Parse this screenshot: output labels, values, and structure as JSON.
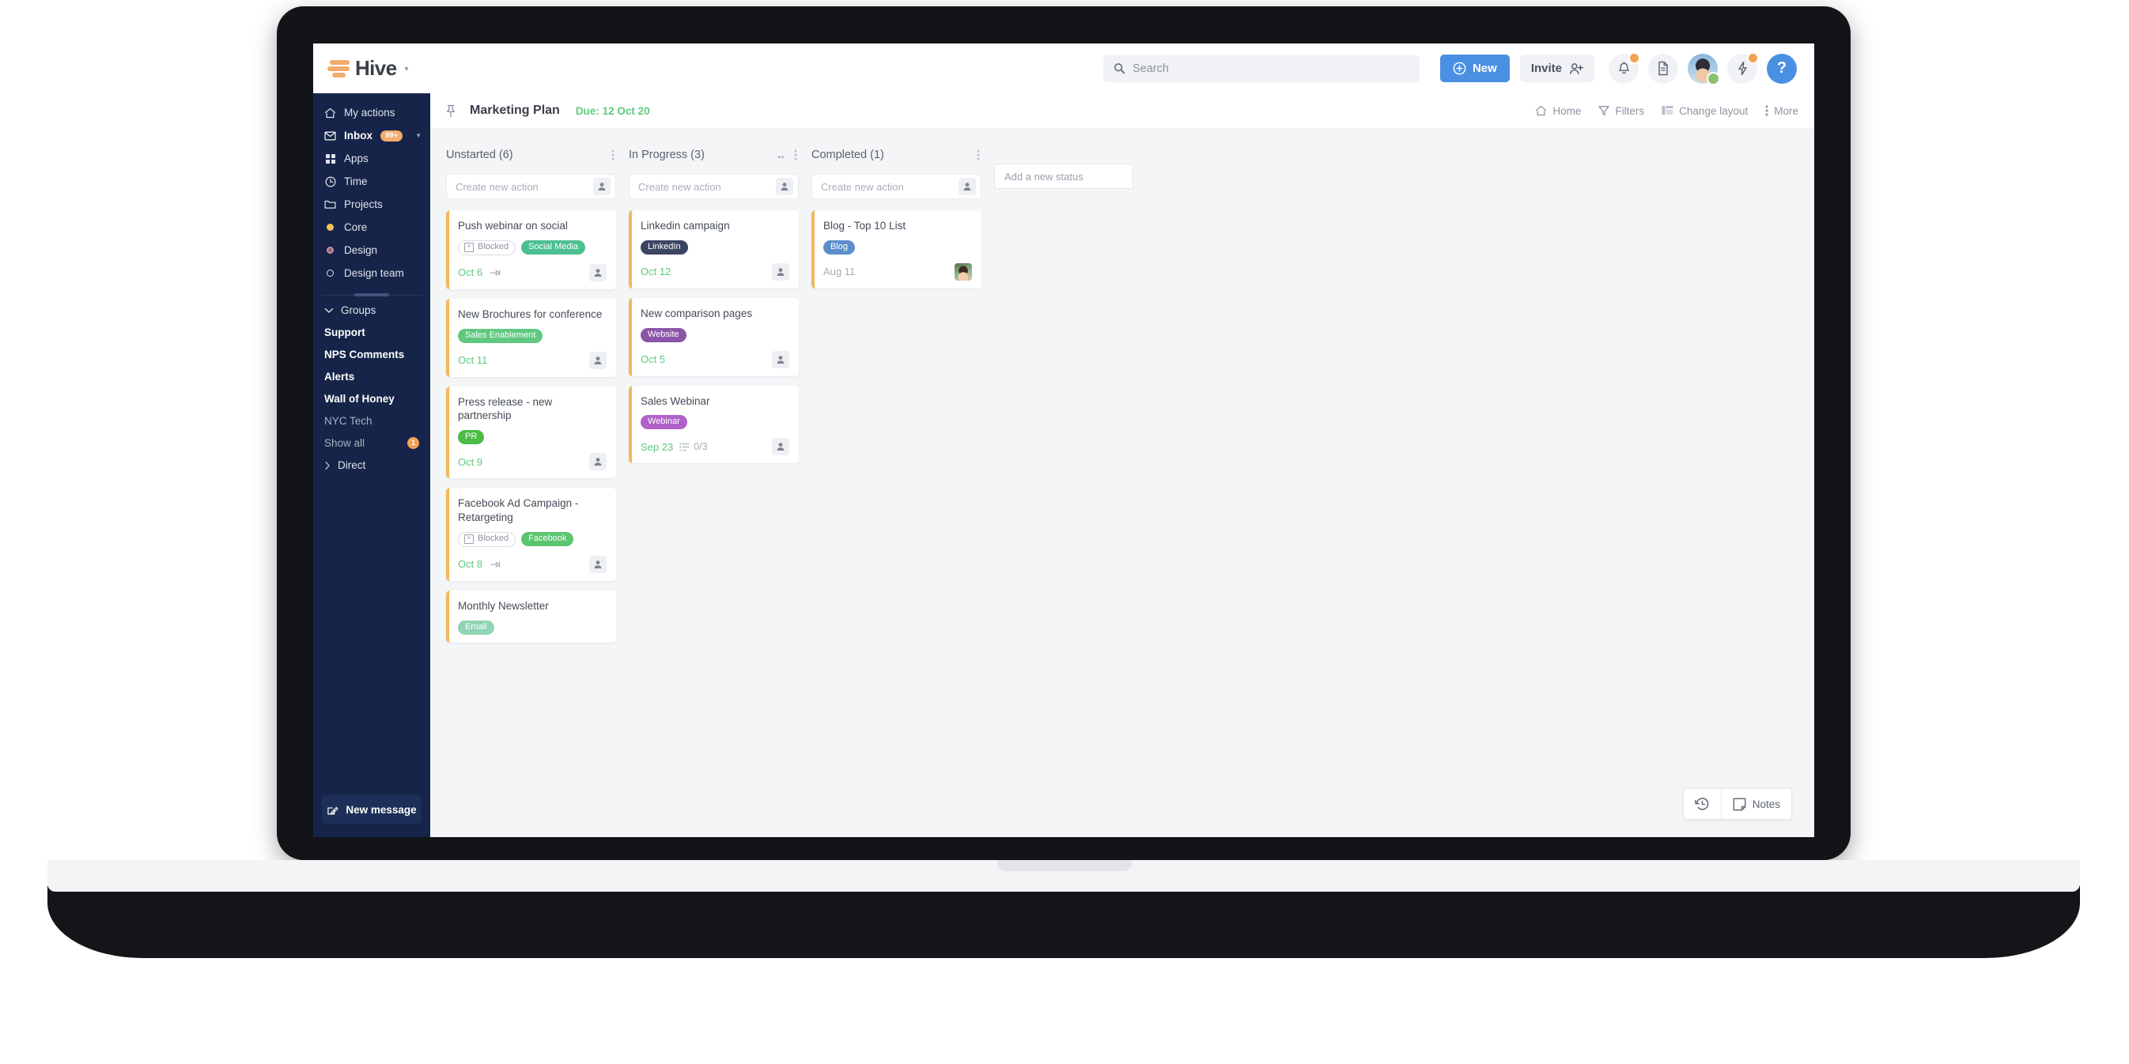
{
  "brand": {
    "name": "Hive",
    "logo_bars_color": "#f2ab6b",
    "accent_blue": "#4a90e2",
    "sidebar_color": "#152448",
    "due_green": "#5fc97f"
  },
  "topbar": {
    "search_placeholder": "Search",
    "new_label": "New",
    "invite_label": "Invite",
    "help_label": "?",
    "icons": [
      "bell-icon",
      "document-icon",
      "avatar",
      "lightning-icon",
      "help-icon"
    ]
  },
  "sidebar": {
    "nav": [
      {
        "label": "My actions",
        "icon": "home-icon",
        "bold": false
      },
      {
        "label": "Inbox",
        "icon": "envelope-icon",
        "bold": true,
        "badge": "99+",
        "caret": true
      },
      {
        "label": "Apps",
        "icon": "grid-icon",
        "bold": false
      },
      {
        "label": "Time",
        "icon": "clock-icon",
        "bold": false
      },
      {
        "label": "Projects",
        "icon": "folder-icon",
        "bold": false
      },
      {
        "label": "Core",
        "icon": "dot-icon",
        "dot_color": "#f5c05e",
        "bold": false
      },
      {
        "label": "Design",
        "icon": "dot-icon",
        "dot_color": "#9b5f7a",
        "bold": false
      },
      {
        "label": "Design team",
        "icon": "circle-outline-icon",
        "bold": false
      }
    ],
    "groups_label": "Groups",
    "groups": [
      {
        "label": "Support",
        "muted": false
      },
      {
        "label": "NPS Comments",
        "muted": false
      },
      {
        "label": "Alerts",
        "muted": false
      },
      {
        "label": "Wall of Honey",
        "muted": false
      },
      {
        "label": "NYC Tech",
        "muted": true
      },
      {
        "label": "Show all",
        "muted": true,
        "count": "1"
      }
    ],
    "direct_label": "Direct",
    "new_message_label": "New message"
  },
  "project": {
    "title": "Marketing Plan",
    "due_text": "Due: 12 Oct 20",
    "tools": [
      {
        "label": "Home",
        "icon": "home-icon"
      },
      {
        "label": "Filters",
        "icon": "filter-icon"
      },
      {
        "label": "Change layout",
        "icon": "layout-icon"
      },
      {
        "label": "More",
        "icon": "kebab-icon"
      }
    ]
  },
  "board": {
    "create_placeholder": "Create new action",
    "add_status_placeholder": "Add a new status",
    "columns": [
      {
        "title": "Unstarted (6)",
        "has_resize": false,
        "cards": [
          {
            "title": "Push webinar on social",
            "labels": [
              {
                "text": "Blocked",
                "type": "blocked"
              },
              {
                "text": "Social Media",
                "color": "#4cc090"
              }
            ],
            "due": "Oct 6",
            "due_gray": false,
            "has_recur_icon": true
          },
          {
            "title": "New Brochures for conference",
            "labels": [
              {
                "text": "Sales Enablement",
                "color": "#5fc97f"
              }
            ],
            "due": "Oct 11",
            "due_gray": false,
            "has_recur_icon": false
          },
          {
            "title": "Press release - new partnership",
            "labels": [
              {
                "text": "PR",
                "color": "#4bbb46"
              }
            ],
            "due": "Oct 9",
            "due_gray": false,
            "has_recur_icon": false
          },
          {
            "title": "Facebook Ad Campaign - Retargeting",
            "labels": [
              {
                "text": "Blocked",
                "type": "blocked"
              },
              {
                "text": "Facebook",
                "color": "#5ac56f"
              }
            ],
            "due": "Oct 8",
            "due_gray": false,
            "has_recur_icon": true
          },
          {
            "title": "Monthly Newsletter",
            "labels": [
              {
                "text": "Email",
                "color": "#8fd4b4"
              }
            ],
            "due": "",
            "due_gray": false,
            "has_recur_icon": false,
            "clipped": true
          }
        ]
      },
      {
        "title": "In Progress (3)",
        "has_resize": true,
        "cards": [
          {
            "title": "Linkedin campaign",
            "labels": [
              {
                "text": "LinkedIn",
                "color": "#3a4562"
              }
            ],
            "due": "Oct 12",
            "due_gray": false,
            "has_recur_icon": false
          },
          {
            "title": "New comparison pages",
            "labels": [
              {
                "text": "Website",
                "color": "#8c55a8"
              }
            ],
            "due": "Oct 5",
            "due_gray": false,
            "has_recur_icon": false
          },
          {
            "title": "Sales Webinar",
            "labels": [
              {
                "text": "Webinar",
                "color": "#b061c9"
              }
            ],
            "due": "Sep 23",
            "due_gray": false,
            "has_recur_icon": false,
            "subtasks": "0/3"
          }
        ]
      },
      {
        "title": "Completed (1)",
        "has_resize": false,
        "cards": [
          {
            "title": "Blog - Top 10 List",
            "labels": [
              {
                "text": "Blog",
                "color": "#5c8ecb"
              }
            ],
            "due": "Aug 11",
            "due_gray": true,
            "has_recur_icon": false,
            "avatar_photo": true
          }
        ]
      }
    ]
  },
  "bottom_widget": {
    "history_icon": "history-icon",
    "notes_label": "Notes"
  }
}
